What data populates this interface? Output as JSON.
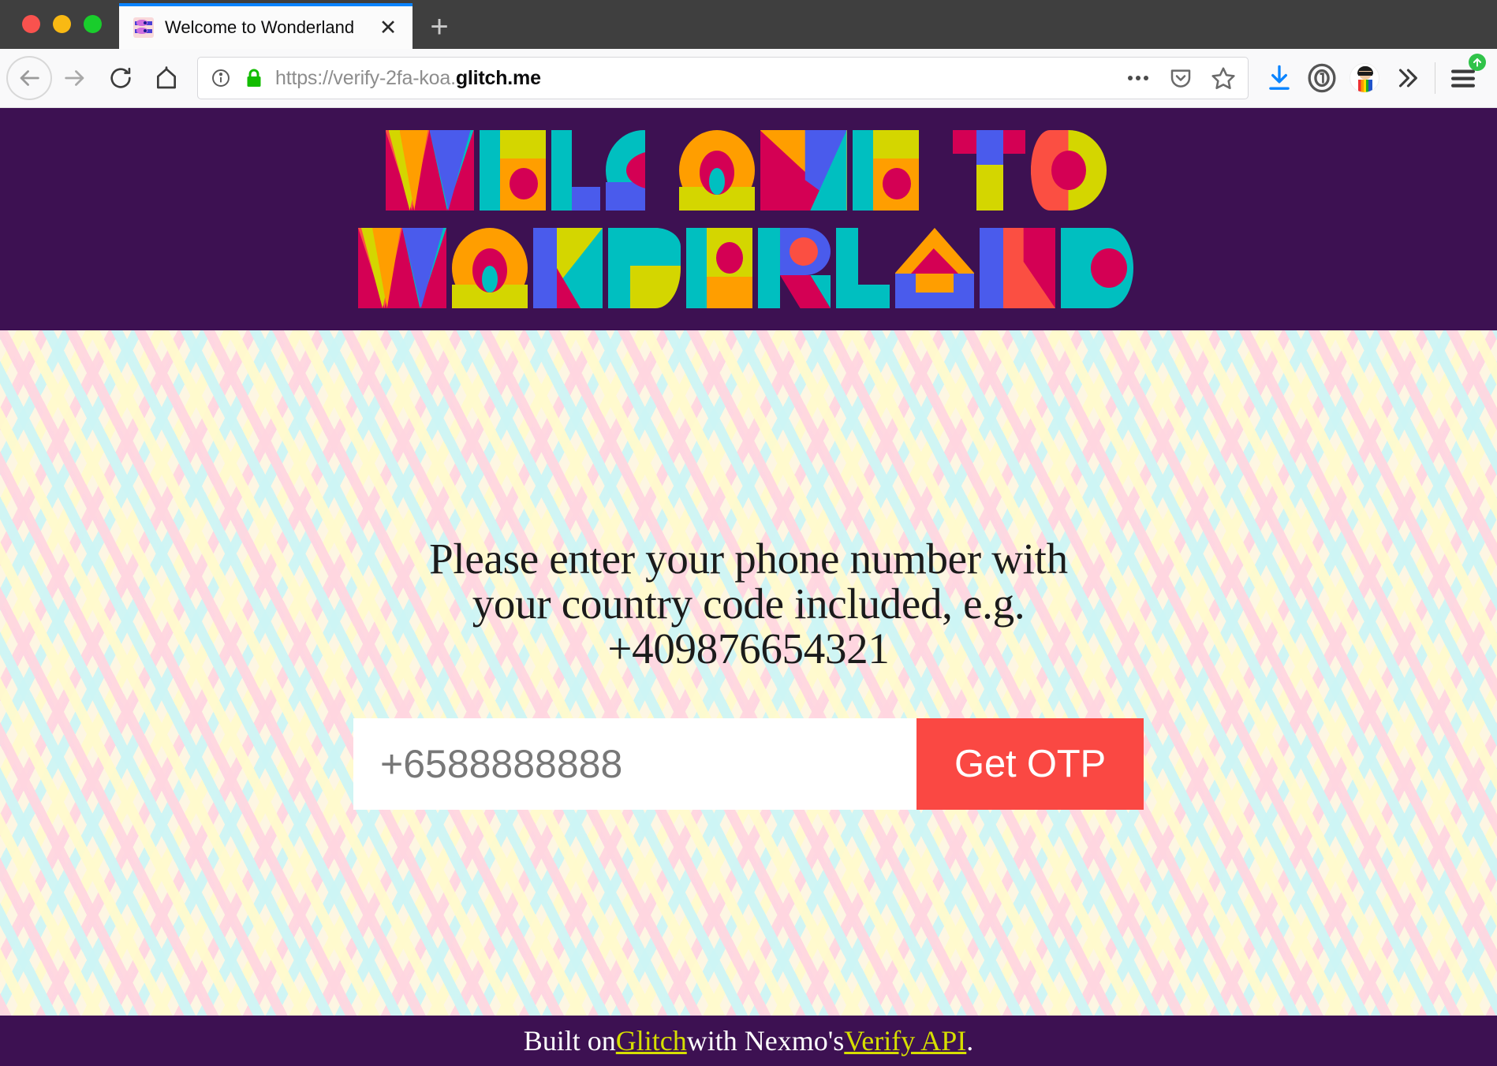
{
  "browser": {
    "tab": {
      "title": "Welcome to Wonderland",
      "close_label": "✕",
      "favicon_name": "wonderland-favicon"
    },
    "new_tab_label": "+",
    "nav": {
      "back_label": "←",
      "forward_label": "→",
      "reload_label": "↻",
      "home_label": "⌂"
    },
    "url": {
      "prefix": "https://verify-2fa-koa.",
      "domain": "glitch.me",
      "full": "https://verify-2fa-koa.glitch.me",
      "security_state": "secure",
      "identity_icon": "info-circle-icon",
      "lock_icon": "padlock-icon",
      "lock_color": "#12bc00"
    },
    "url_actions": [
      {
        "name": "page-actions-icon",
        "label": "•••"
      },
      {
        "name": "pocket-icon",
        "label": "pocket"
      },
      {
        "name": "bookmark-star-icon",
        "label": "star"
      }
    ],
    "toolbar_icons": [
      {
        "name": "downloads-icon",
        "label": "download",
        "color": "#0a84ff"
      },
      {
        "name": "onepassword-icon",
        "label": "1password",
        "color": "#58595b"
      },
      {
        "name": "account-avatar-icon",
        "label": "avatar",
        "color": "#1c1c1c"
      },
      {
        "name": "overflow-chevrons-icon",
        "label": "»",
        "color": "#3b3b3b"
      },
      {
        "name": "hamburger-menu-icon",
        "label": "menu",
        "color": "#3b3b3b",
        "badge_color": "#30c349"
      }
    ]
  },
  "page": {
    "header": {
      "logo_line_1": "WELCOME TO",
      "logo_line_2": "WONDERLAND",
      "background_color": "#3D1152",
      "palette": {
        "purple": "#3D1152",
        "teal": "#00BFC0",
        "yellow": "#D4D600",
        "orange": "#FF9E00",
        "magenta": "#D40054",
        "blue": "#4A5BEC",
        "coral": "#FB4F42"
      }
    },
    "main": {
      "prompt": "Please enter your phone number with your country code included, e.g. +409876654321",
      "prompt_lines": [
        "Please enter your phone number with",
        "your country code included, e.g.",
        "+409876654321"
      ],
      "phone_input": {
        "value": "",
        "placeholder": "+6588888888"
      },
      "submit_label": "Get OTP",
      "submit_color": "#FA4843"
    },
    "footer": {
      "prefix": "Built on ",
      "link_1": "Glitch",
      "middle": " with Nexmo's ",
      "link_2": "Verify API",
      "suffix": ".",
      "link_color": "#D6DE00",
      "background_color": "#3D1152"
    }
  }
}
